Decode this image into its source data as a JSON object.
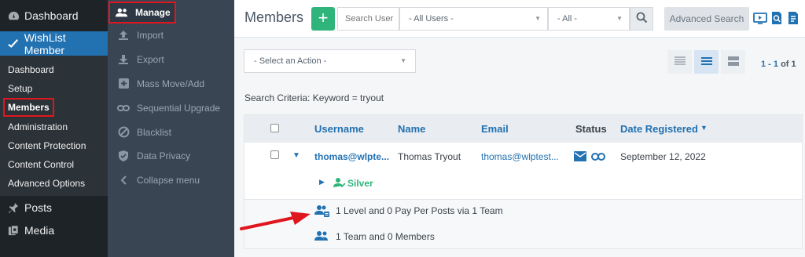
{
  "wp_sidebar": {
    "dashboard": "Dashboard",
    "plugin": "WishList Member",
    "sub_items": [
      "Dashboard",
      "Setup",
      "Members",
      "Administration",
      "Content Protection",
      "Content Control",
      "Advanced Options"
    ],
    "posts": "Posts",
    "media": "Media"
  },
  "wlm_nav": {
    "manage": "Manage",
    "items": [
      "Import",
      "Export",
      "Mass Move/Add",
      "Sequential Upgrade",
      "Blacklist",
      "Data Privacy",
      "Collapse menu"
    ]
  },
  "header": {
    "title": "Members",
    "add_label": "+",
    "search_placeholder": "Search User",
    "users_filter": "- All Users -",
    "all_filter": "- All -",
    "advanced_search": "Advanced Search"
  },
  "toolbar": {
    "action_select": "- Select an Action -",
    "pager_range": "1 - 1",
    "pager_of": "of 1"
  },
  "criteria": "Search Criteria: Keyword = tryout",
  "table": {
    "columns": [
      "Username",
      "Name",
      "Email",
      "Status",
      "Date Registered"
    ],
    "row": {
      "username": "thomas@wlpte...",
      "name": "Thomas Tryout",
      "email": "thomas@wlptest...",
      "date": "September 12, 2022",
      "level": "Silver"
    },
    "summary_line1": "1 Level and 0 Pay Per Posts via 1 Team",
    "summary_line2": "1 Team and 0 Members"
  },
  "colors": {
    "wp_blue": "#2271b1",
    "green": "#2fb57b",
    "highlight_red": "#e0161f"
  }
}
